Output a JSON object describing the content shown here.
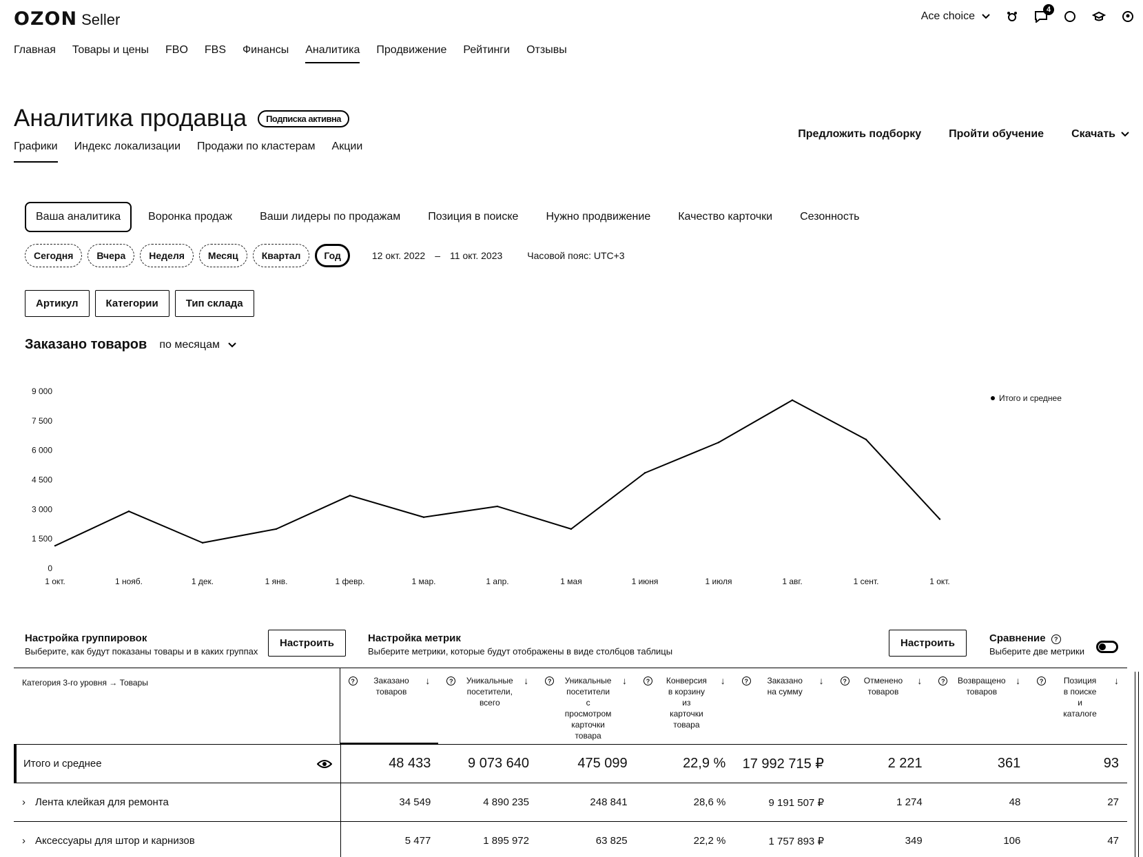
{
  "header": {
    "logo_main": "OZON",
    "logo_sub": "Seller",
    "account": "Ace choice",
    "notifications_count": "4"
  },
  "main_nav": [
    {
      "label": "Главная"
    },
    {
      "label": "Товары и цены"
    },
    {
      "label": "FBO"
    },
    {
      "label": "FBS"
    },
    {
      "label": "Финансы"
    },
    {
      "label": "Аналитика",
      "active": true
    },
    {
      "label": "Продвижение"
    },
    {
      "label": "Рейтинги"
    },
    {
      "label": "Отзывы"
    }
  ],
  "page": {
    "title": "Аналитика продавца",
    "subscription_badge": "Подписка активна"
  },
  "sub_nav": [
    {
      "label": "Графики",
      "active": true
    },
    {
      "label": "Индекс локализации"
    },
    {
      "label": "Продажи по кластерам"
    },
    {
      "label": "Акции"
    }
  ],
  "actions": {
    "suggest": "Предложить подборку",
    "training": "Пройти обучение",
    "download": "Скачать"
  },
  "analytics_tabs": [
    {
      "label": "Ваша аналитика",
      "active": true
    },
    {
      "label": "Воронка продаж"
    },
    {
      "label": "Ваши лидеры по продажам"
    },
    {
      "label": "Позиция в поиске"
    },
    {
      "label": "Нужно продвижение"
    },
    {
      "label": "Качество карточки"
    },
    {
      "label": "Сезонность"
    }
  ],
  "period": {
    "chips": [
      {
        "label": "Сегодня"
      },
      {
        "label": "Вчера"
      },
      {
        "label": "Неделя"
      },
      {
        "label": "Месяц"
      },
      {
        "label": "Квартал"
      },
      {
        "label": "Год",
        "active": true
      }
    ],
    "date_from": "12 окт. 2022",
    "date_sep": "–",
    "date_to": "11 окт. 2023",
    "timezone": "Часовой пояс: UTC+3"
  },
  "filters": {
    "article": "Артикул",
    "categories": "Категории",
    "warehouse": "Тип склада"
  },
  "metric": {
    "title": "Заказано товаров",
    "granularity": "по месяцам"
  },
  "chart_data": {
    "type": "line",
    "x": [
      "1 окт.",
      "1 нояб.",
      "1 дек.",
      "1 янв.",
      "1 февр.",
      "1 мар.",
      "1 апр.",
      "1 мая",
      "1 июня",
      "1 июля",
      "1 авг.",
      "1 сент.",
      "1 окт."
    ],
    "y_ticks": [
      "0",
      "1 500",
      "3 000",
      "4 500",
      "6 000",
      "7 500",
      "9 000"
    ],
    "ylim": [
      0,
      9000
    ],
    "series": [
      {
        "name": "Итого и среднее",
        "values": [
          1150,
          2900,
          1300,
          2000,
          3700,
          2600,
          3150,
          2000,
          4850,
          6400,
          8550,
          6550,
          2500
        ]
      }
    ],
    "legend_position": "top-right"
  },
  "settings": {
    "grouping_title": "Настройка группировок",
    "grouping_desc": "Выберите, как будут показаны товары и в каких группах",
    "grouping_btn": "Настроить",
    "metrics_title": "Настройка метрик",
    "metrics_desc": "Выберите метрики, которые будут отображены в виде столбцов таблицы",
    "metrics_btn": "Настроить",
    "compare_title": "Сравнение",
    "compare_desc": "Выберите две метрики"
  },
  "table": {
    "first_header": "Категория 3-го уровня → Товары",
    "columns": [
      "Заказано\nтоваров",
      "Уникальные\nпосетители,\nвсего",
      "Уникальные\nпосетители\nс\nпросмотром\nкарточки\nтовара",
      "Конверсия\nв корзину\nиз\nкарточки\nтовара",
      "Заказано\nна сумму",
      "Отменено\nтоваров",
      "Возвращено\nтоваров",
      "Позиция\nв поиске\nи\nкаталоге"
    ],
    "rows": [
      {
        "name": "Итого и среднее",
        "values": [
          "48 433",
          "9 073 640",
          "475 099",
          "22,9 %",
          "17 992 715 ₽",
          "2 221",
          "361",
          "93"
        ]
      },
      {
        "name": "Лента клейкая для ремонта",
        "values": [
          "34 549",
          "4 890 235",
          "248 841",
          "28,6 %",
          "9 191 507 ₽",
          "1 274",
          "48",
          "27"
        ]
      },
      {
        "name": "Аксессуары для штор и карнизов",
        "values": [
          "5 477",
          "1 895 972",
          "63 825",
          "22,2 %",
          "1 757 893 ₽",
          "349",
          "106",
          "47"
        ]
      }
    ]
  }
}
